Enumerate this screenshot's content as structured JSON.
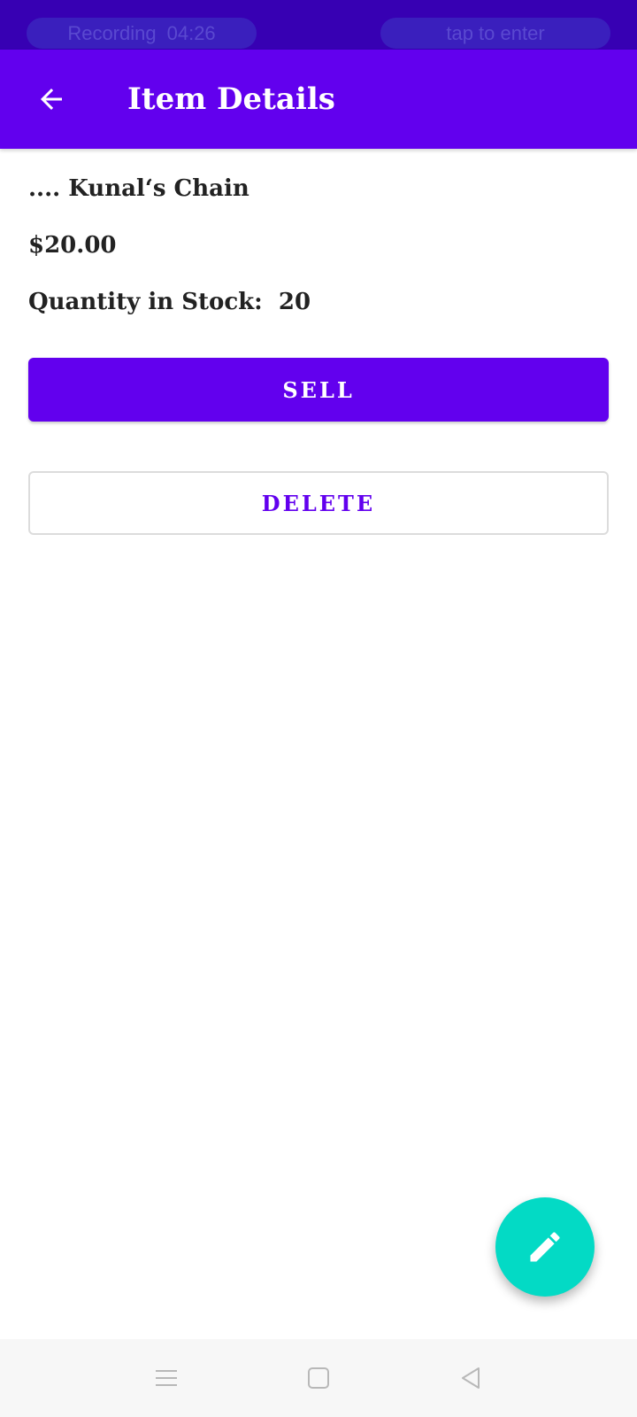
{
  "status_bar": {
    "recording_label": "Recording",
    "recording_time": "04:26",
    "tap_label": "tap to enter"
  },
  "app_bar": {
    "title": "Item Details",
    "back_icon": "arrow-back-icon",
    "color": "#6200ee"
  },
  "item": {
    "name": ".... Kunal‘s Chain",
    "price": "$20.00",
    "quantity_label": "Quantity in Stock:",
    "quantity_value": "20"
  },
  "actions": {
    "sell_label": "SELL",
    "delete_label": "DELETE"
  },
  "fab": {
    "icon": "pencil-edit-icon",
    "color": "#03dac5"
  },
  "nav_bar": {
    "icons": [
      "menu-icon",
      "home-square-icon",
      "back-triangle-icon"
    ]
  }
}
